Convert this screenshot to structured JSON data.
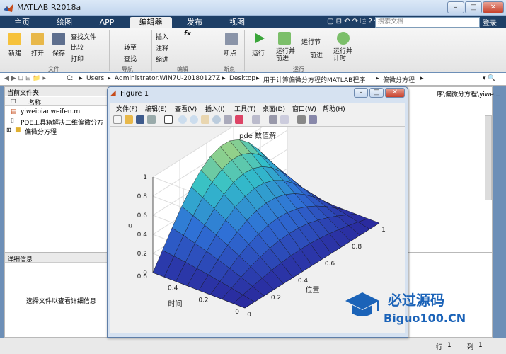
{
  "window": {
    "title": "MATLAB R2018a"
  },
  "tabs": [
    "主页",
    "绘图",
    "APP",
    "编辑器",
    "发布",
    "视图"
  ],
  "active_tab": "编辑器",
  "search_placeholder": "搜索文档",
  "login": "登录",
  "ribbon": {
    "file": {
      "new": "新建",
      "open": "打开",
      "save": "保存",
      "find_files": "查找文件",
      "compare": "比较",
      "print": "打印",
      "group": "文件"
    },
    "nav": {
      "goto": "转至",
      "find": "查找",
      "group": "导航"
    },
    "edit": {
      "insert": "插入",
      "comment": "注释",
      "indent": "缩进",
      "fx": "fx",
      "group": "编辑"
    },
    "breakpoints": {
      "label": "断点",
      "group": "断点"
    },
    "run": {
      "run": "运行",
      "run_advance": "运行并\n前进",
      "run_section": "运行节",
      "advance": "前进",
      "run_time": "运行并\n计时",
      "group": "运行"
    }
  },
  "address": {
    "parts": [
      "C:",
      "Users",
      "Administrator.WIN7U-20180127Z",
      "Desktop",
      "用于计算偏微分方程的MATLAB程序",
      "偏微分方程"
    ]
  },
  "current_folder": {
    "title": "当前文件夹",
    "col_name": "名称",
    "items": [
      "yiweipianweifen.m",
      "PDE工具箱解决二维偏微分方",
      "偏微分方程"
    ]
  },
  "details": {
    "title": "详细信息",
    "hint": "选择文件以查看详细信息"
  },
  "right_panel": {
    "path_fragment": "序\\偏微分方程\\yiwe..."
  },
  "status": {
    "row_label": "行",
    "row": "1",
    "col_label": "列",
    "col": "1"
  },
  "figure": {
    "title": "Figure 1",
    "menu": [
      "文件(F)",
      "编辑(E)",
      "查看(V)",
      "插入(I)",
      "工具(T)",
      "桌面(D)",
      "窗口(W)",
      "帮助(H)"
    ]
  },
  "chart_data": {
    "type": "surface",
    "title": "pde 数值解",
    "xlabel": "位置",
    "ylabel": "时间",
    "zlabel": "u",
    "x_ticks": [
      "0",
      "0.2",
      "0.4",
      "0.6",
      "0.8",
      "1"
    ],
    "y_ticks": [
      "0",
      "0.2",
      "0.4",
      "0.6"
    ],
    "z_ticks": [
      "0",
      "0.2",
      "0.4",
      "0.6",
      "0.8",
      "1"
    ],
    "xlim": [
      0,
      1
    ],
    "ylim": [
      0,
      0.6
    ],
    "zlim": [
      0,
      1
    ],
    "grid": true,
    "colormap": [
      "#2a2a9e",
      "#2f6fd6",
      "#33c1c9",
      "#f2e04a"
    ]
  },
  "watermark": {
    "cn": "必过源码",
    "en": "Biguo100.CN"
  }
}
